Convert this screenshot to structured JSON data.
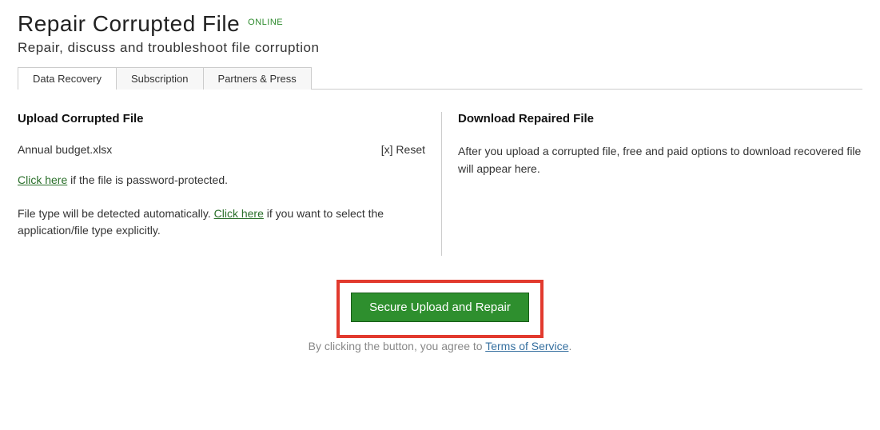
{
  "header": {
    "title": "Repair Corrupted File",
    "badge": "ONLINE",
    "subtitle": "Repair, discuss and troubleshoot file corruption"
  },
  "tabs": {
    "data_recovery": "Data Recovery",
    "subscription": "Subscription",
    "partners": "Partners & Press"
  },
  "left": {
    "heading": "Upload Corrupted File",
    "filename": "Annual budget.xlsx",
    "reset": "[x] Reset",
    "pwd_link": "Click here",
    "pwd_text": " if the file is password-protected.",
    "detect_pre": "File type will be detected automatically. ",
    "detect_link": "Click here",
    "detect_post": " if you want to select the application/file type explicitly."
  },
  "right": {
    "heading": "Download Repaired File",
    "body": "After you upload a corrupted file, free and paid options to download recovered file will appear here."
  },
  "upload": {
    "button": "Secure Upload and Repair",
    "agree_pre": "By clicking the button, you agree to ",
    "tos": "Terms of Service",
    "agree_post": "."
  }
}
